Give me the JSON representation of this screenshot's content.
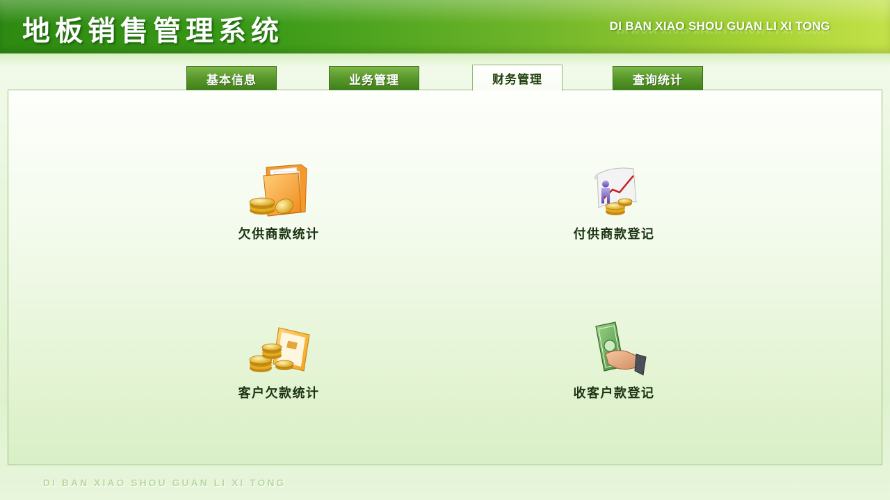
{
  "header": {
    "title": "地板销售管理系统",
    "subtitle": "DI BAN XIAO SHOU GUAN LI XI TONG"
  },
  "tabs": [
    {
      "label": "基本信息",
      "active": false
    },
    {
      "label": "业务管理",
      "active": false
    },
    {
      "label": "财务管理",
      "active": true
    },
    {
      "label": "查询统计",
      "active": false
    }
  ],
  "functions": [
    {
      "label": "欠供商款统计",
      "icon": "folder-coins-icon"
    },
    {
      "label": "付供商款登记",
      "icon": "chart-person-coins-icon"
    },
    {
      "label": "客户欠款统计",
      "icon": "coins-card-icon"
    },
    {
      "label": "收客户款登记",
      "icon": "hand-banknote-icon"
    }
  ],
  "footer": {
    "text": "DI BAN XIAO SHOU GUAN LI XI TONG"
  },
  "colors": {
    "header_dark": "#2e8a12",
    "header_light": "#c3e24a",
    "tab_green": "#5a9a2c",
    "label_text": "#1a3312"
  }
}
